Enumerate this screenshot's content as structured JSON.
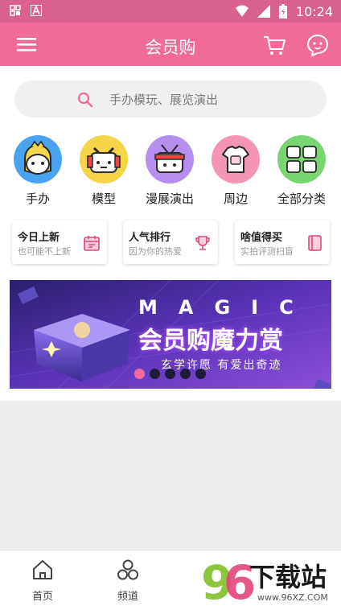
{
  "statusbar": {
    "time": "10:24"
  },
  "appbar": {
    "title": "会员购"
  },
  "search": {
    "placeholder": "手办模玩、展览演出"
  },
  "categories": [
    {
      "label": "手办",
      "color": "#4aa3f0"
    },
    {
      "label": "模型",
      "color": "#f5d447"
    },
    {
      "label": "漫展演出",
      "color": "#b68ef0"
    },
    {
      "label": "周边",
      "color": "#f595b4"
    },
    {
      "label": "全部分类",
      "color": "#77d66f"
    }
  ],
  "cards": [
    {
      "title": "今日上新",
      "subtitle": "也可能不上新",
      "icon": "calendar-icon"
    },
    {
      "title": "人气排行",
      "subtitle": "因为你的热爱",
      "icon": "trophy-icon"
    },
    {
      "title": "啥值得买",
      "subtitle": "实拍评测扫盲",
      "icon": "book-icon"
    }
  ],
  "banner": {
    "magic": "MAGIC",
    "title": "会员购魔力赏",
    "subtitle": "玄学许愿 有爱出奇迹",
    "slide_count": 5,
    "active_slide": 1
  },
  "tabs": [
    {
      "label": "首页",
      "icon": "home-icon"
    },
    {
      "label": "频道",
      "icon": "channels-icon"
    }
  ],
  "watermark": {
    "text": "96下载站",
    "url": "www.96XZ.COM"
  }
}
